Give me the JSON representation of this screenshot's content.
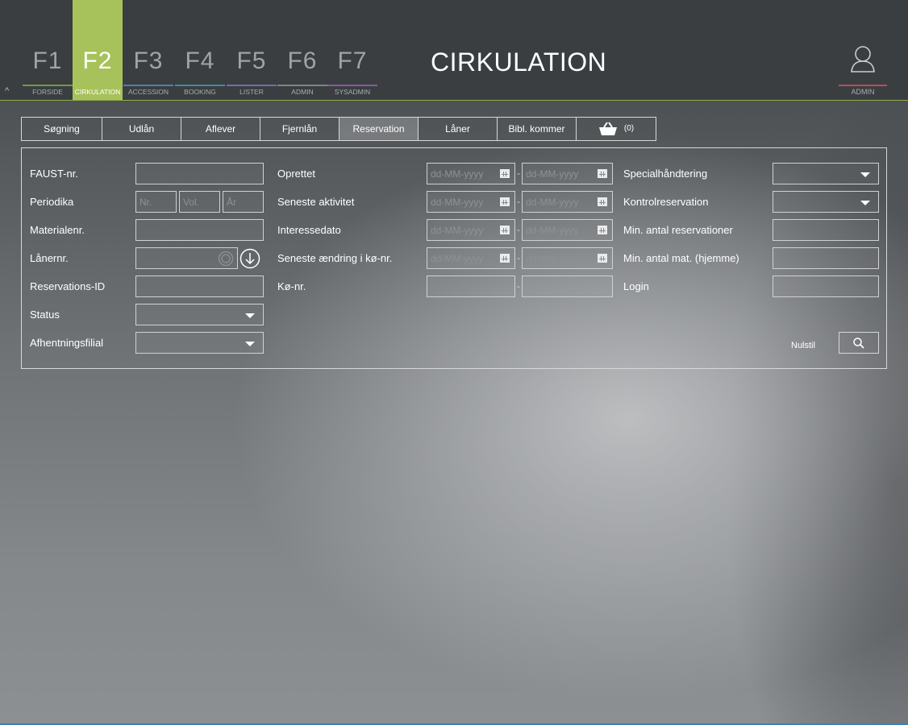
{
  "nav": {
    "collapse_glyph": "^",
    "fkeys": [
      {
        "key": "F1",
        "label": "FORSIDE",
        "color": "#6f9a45",
        "active": false
      },
      {
        "key": "F2",
        "label": "CIRKULATION",
        "color": "#a8c25b",
        "active": true
      },
      {
        "key": "F3",
        "label": "ACCESSION",
        "color": "#4f7fb0",
        "active": false
      },
      {
        "key": "F4",
        "label": "BOOKING",
        "color": "#3f8f9a",
        "active": false
      },
      {
        "key": "F5",
        "label": "LISTER",
        "color": "#7a6aa8",
        "active": false
      },
      {
        "key": "F6",
        "label": "ADMIN",
        "color": "#7f8488",
        "active": false
      },
      {
        "key": "F7",
        "label": "SYSADMIN",
        "color": "#8a5a9a",
        "active": false
      }
    ]
  },
  "header": {
    "title": "CIRKULATION",
    "user_label": "ADMIN",
    "user_icon": "user-icon"
  },
  "tabs": [
    {
      "label": "Søgning",
      "active": false
    },
    {
      "label": "Udlån",
      "active": false
    },
    {
      "label": "Aflever",
      "active": false
    },
    {
      "label": "Fjernlån",
      "active": false
    },
    {
      "label": "Reservation",
      "active": true
    },
    {
      "label": "Låner",
      "active": false
    },
    {
      "label": "Bibl. kommer",
      "active": false
    }
  ],
  "basket": {
    "icon": "basket-icon",
    "count": "(0)"
  },
  "form": {
    "col1": {
      "faust_label": "FAUST-nr.",
      "periodika_label": "Periodika",
      "periodika_nr_placeholder": "Nr.",
      "periodika_vol_placeholder": "Vol.",
      "periodika_aar_placeholder": "År",
      "materialenr_label": "Materialenr.",
      "laanernr_label": "Lånernr.",
      "reservations_id_label": "Reservations-ID",
      "status_label": "Status",
      "afhentningsfilial_label": "Afhentningsfilial"
    },
    "col2": {
      "oprettet_label": "Oprettet",
      "seneste_aktivitet_label": "Seneste aktivitet",
      "interessedato_label": "Interessedato",
      "seneste_aendring_label": "Seneste ændring i kø-nr.",
      "koe_nr_label": "Kø-nr.",
      "date_placeholder": "dd-MM-yyyy",
      "range_separator": "-"
    },
    "col3": {
      "specialhaandtering_label": "Specialhåndtering",
      "kontrolreservation_label": "Kontrolreservation",
      "min_antal_reservationer_label": "Min. antal reservationer",
      "min_antal_mat_label": "Min. antal mat. (hjemme)",
      "login_label": "Login"
    },
    "actions": {
      "reset_label": "Nulstil",
      "search_icon": "search-icon"
    }
  },
  "colors": {
    "active_accent": "#a8c25b",
    "admin_accent": "#b4505a"
  }
}
